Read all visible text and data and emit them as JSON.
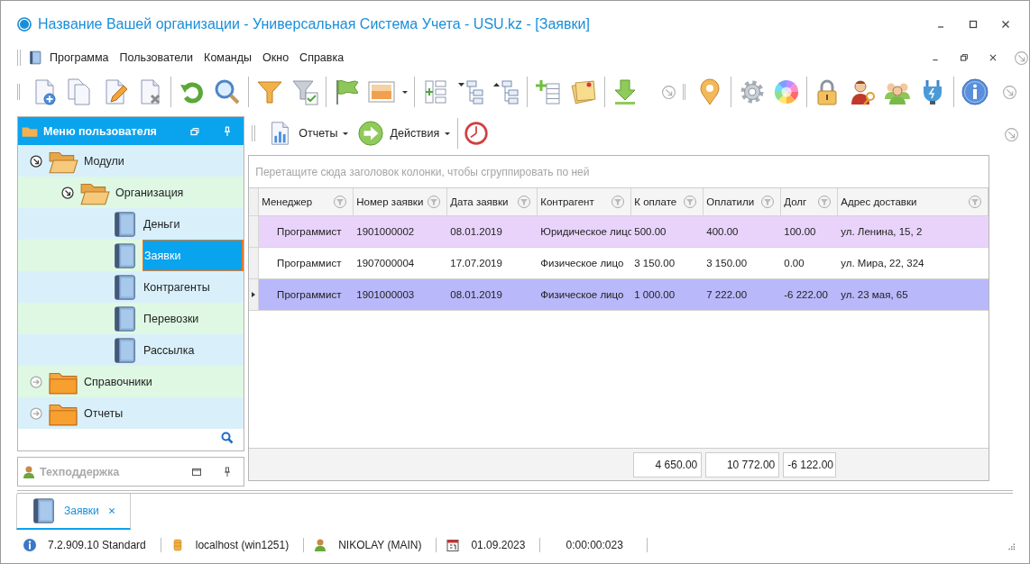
{
  "window": {
    "title": "Название Вашей организации - Универсальная Система Учета - USU.kz - [Заявки]"
  },
  "menu": [
    "Программа",
    "Пользователи",
    "Команды",
    "Окно",
    "Справка"
  ],
  "sidebar": {
    "title": "Меню пользователя",
    "tree": [
      {
        "label": "Модули",
        "kind": "folder",
        "expanded": true,
        "selected": false,
        "children": [
          {
            "label": "Организация",
            "kind": "folder",
            "expanded": true,
            "selected": false,
            "children": [
              {
                "label": "Деньги",
                "kind": "module",
                "selected": false
              },
              {
                "label": "Заявки",
                "kind": "module",
                "selected": true
              },
              {
                "label": "Контрагенты",
                "kind": "module",
                "selected": false
              },
              {
                "label": "Перевозки",
                "kind": "module",
                "selected": false
              },
              {
                "label": "Рассылка",
                "kind": "module",
                "selected": false
              }
            ]
          }
        ]
      },
      {
        "label": "Справочники",
        "kind": "folder",
        "expanded": false,
        "selected": false
      },
      {
        "label": "Отчеты",
        "kind": "folder",
        "expanded": false,
        "selected": false
      }
    ]
  },
  "support_panel": {
    "title": "Техподдержка"
  },
  "content_toolbar": [
    {
      "label": "Отчеты",
      "kind": "reports"
    },
    {
      "label": "Действия",
      "kind": "actions"
    }
  ],
  "group_panel": {
    "placeholder": "Перетащите сюда заголовок колонки, чтобы сгруппировать по ней"
  },
  "table": {
    "columns": [
      {
        "label": "Менеджер"
      },
      {
        "label": "Номер заявки"
      },
      {
        "label": "Дата заявки"
      },
      {
        "label": "Контрагент"
      },
      {
        "label": "К оплате",
        "total": "4 650.00"
      },
      {
        "label": "Оплатили",
        "total": "10 772.00"
      },
      {
        "label": "Долг",
        "total": "-6 122.00"
      },
      {
        "label": "Адрес доставки"
      }
    ],
    "rows": [
      {
        "cells": [
          "Программист",
          "1901000002",
          "08.01.2019",
          "Юридическое лицо",
          "500.00",
          "400.00",
          "100.00",
          "ул. Ленина, 15, 2"
        ],
        "color": "#e9d3fb",
        "selected": false
      },
      {
        "cells": [
          "Программист",
          "1907000004",
          "17.07.2019",
          "Физическое лицо",
          "3 150.00",
          "3 150.00",
          "0.00",
          "ул. Мира, 22, 324"
        ],
        "color": "#ffffff",
        "selected": false
      },
      {
        "cells": [
          "Программист",
          "1901000003",
          "08.01.2019",
          "Физическое лицо",
          "1 000.00",
          "7 222.00",
          "-6 222.00",
          "ул. 23 мая, 65"
        ],
        "color": "#b8b8fb",
        "selected": true
      }
    ]
  },
  "document_tabs": [
    {
      "label": "Заявки",
      "selected": true
    }
  ],
  "status_bar": [
    {
      "kind": "version",
      "text": "7.2.909.10 Standard"
    },
    {
      "kind": "database",
      "text": "localhost (win1251)"
    },
    {
      "kind": "user",
      "text": "NIKOLAY (MAIN)"
    },
    {
      "kind": "date",
      "text": "01.09.2023"
    },
    {
      "kind": "timer",
      "text": "0:00:00:023"
    }
  ]
}
